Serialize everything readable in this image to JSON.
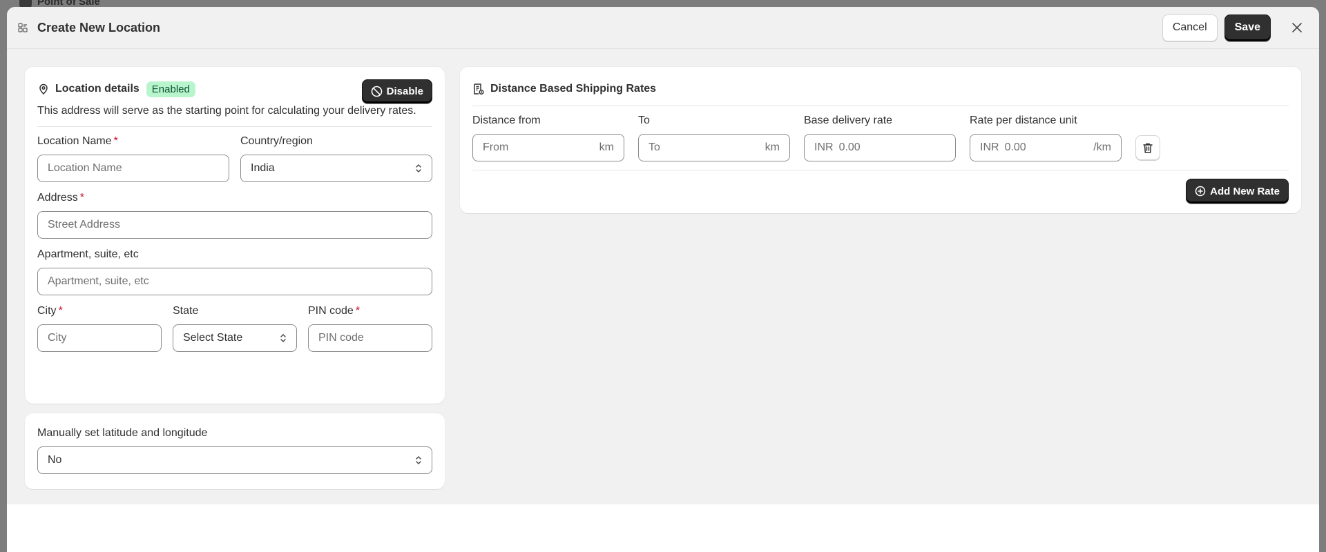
{
  "background": {
    "app_title": "Point of Sale"
  },
  "modal": {
    "title": "Create New Location",
    "cancel_label": "Cancel",
    "save_label": "Save"
  },
  "location_details": {
    "title": "Location details",
    "status_badge": "Enabled",
    "disable_label": "Disable",
    "description": "This address will serve as the starting point for calculating your delivery rates.",
    "location_name": {
      "label": "Location Name",
      "placeholder": "Location Name"
    },
    "country": {
      "label": "Country/region",
      "value": "India"
    },
    "address": {
      "label": "Address",
      "placeholder": "Street Address"
    },
    "apartment": {
      "label": "Apartment, suite, etc",
      "placeholder": "Apartment, suite, etc"
    },
    "city": {
      "label": "City",
      "placeholder": "City"
    },
    "state": {
      "label": "State",
      "value": "Select State"
    },
    "pin": {
      "label": "PIN code",
      "placeholder": "PIN code"
    },
    "required_mark": "*"
  },
  "latlng": {
    "label": "Manually set latitude and longitude",
    "value": "No"
  },
  "shipping_rates": {
    "title": "Distance Based Shipping Rates",
    "distance_from": {
      "label": "Distance from",
      "placeholder": "From",
      "suffix": "km"
    },
    "to": {
      "label": "To",
      "placeholder": "To",
      "suffix": "km"
    },
    "base_rate": {
      "label": "Base delivery rate",
      "prefix": "INR",
      "placeholder": "0.00"
    },
    "rate_per_unit": {
      "label": "Rate per distance unit",
      "prefix": "INR",
      "placeholder": "0.00",
      "suffix": "/km"
    },
    "add_label": "Add New Rate"
  },
  "colors": {
    "primary_button": "#303030",
    "badge_bg": "#b8f5cc",
    "badge_text": "#0c5132",
    "required": "#c70a24"
  }
}
